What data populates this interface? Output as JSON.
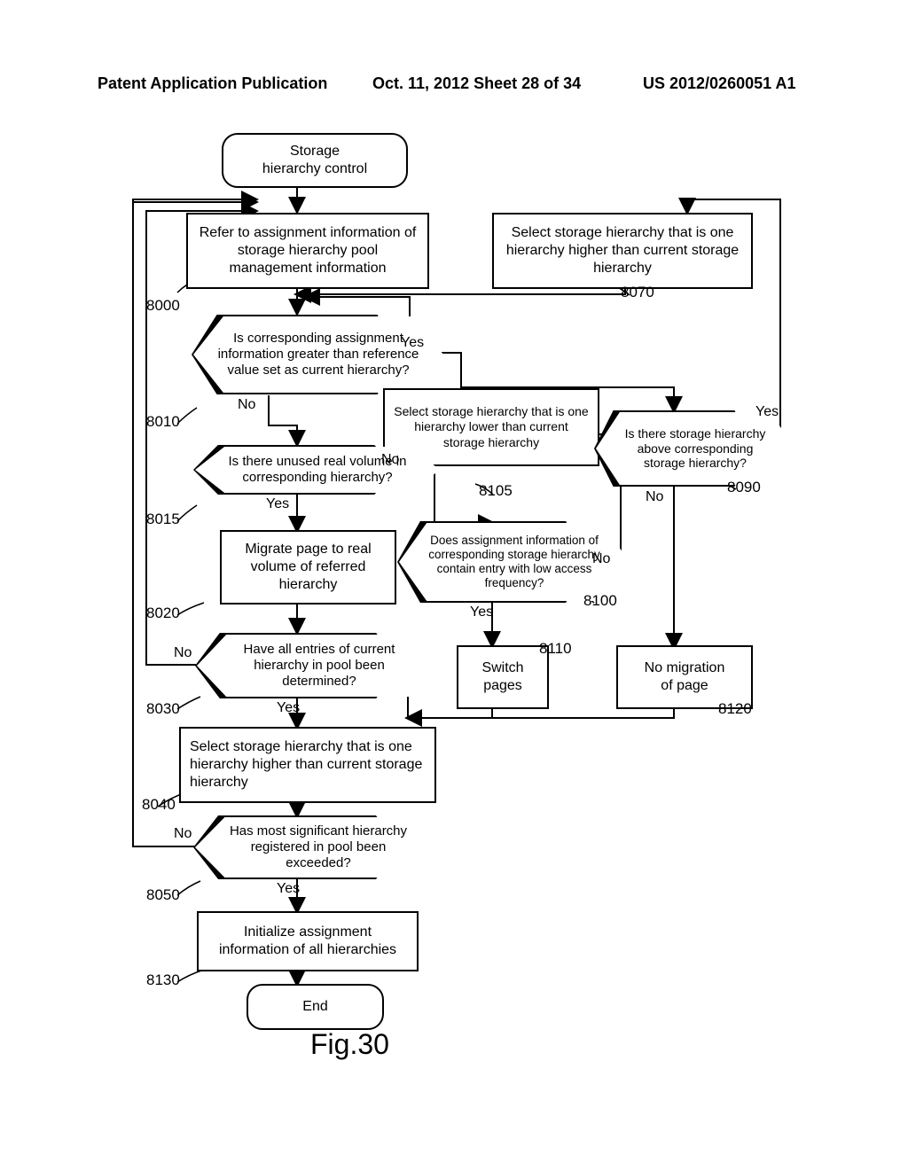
{
  "header": {
    "left": "Patent Application Publication",
    "center": "Oct. 11, 2012  Sheet 28 of 34",
    "right": "US 2012/0260051 A1"
  },
  "figure_label": "Fig.30",
  "nodes": {
    "start": "Storage\nhierarchy control",
    "n8000": "Refer to assignment information of storage hierarchy pool management information",
    "n8070": "Select storage hierarchy that is one hierarchy higher than current storage hierarchy",
    "n8010": "Is corresponding assignment information greater than reference value set as current hierarchy?",
    "n8105": "Select storage hierarchy that is one hierarchy lower than current storage hierarchy",
    "n8090": "Is there storage hierarchy above corresponding storage hierarchy?",
    "n8015": "Is there unused real volume in corresponding hierarchy?",
    "n8020": "Migrate page to real volume of referred hierarchy",
    "n8100": "Does assignment information of corresponding storage hierarchy contain entry with low access frequency?",
    "n8110": "Switch\npages",
    "n8120": "No migration\nof page",
    "n8030": "Have all entries of current hierarchy in pool been determined?",
    "n8040": "Select storage hierarchy that is one hierarchy higher than current storage hierarchy",
    "n8050": "Has most significant hierarchy registered in pool been exceeded?",
    "n8130": "Initialize assignment information of all hierarchies",
    "end": "End"
  },
  "edge_labels": {
    "n8010_yes": "Yes",
    "n8010_no": "No",
    "n8015_yes": "Yes",
    "n8015_no": "No",
    "n8100_yes": "Yes",
    "n8100_no": "No",
    "n8090_yes": "Yes",
    "n8090_no": "No",
    "n8030_yes": "Yes",
    "n8030_no": "No",
    "n8050_yes": "Yes",
    "n8050_no": "No"
  },
  "refs": {
    "r8000": "8000",
    "r8010": "8010",
    "r8015": "8015",
    "r8020": "8020",
    "r8030": "8030",
    "r8040": "8040",
    "r8050": "8050",
    "r8070": "8070",
    "r8090": "8090",
    "r8100": "8100",
    "r8105": "8105",
    "r8110": "8110",
    "r8120": "8120",
    "r8130": "8130"
  },
  "chart_data": {
    "type": "flowchart",
    "title": "Fig.30 — Storage hierarchy control",
    "nodes": [
      {
        "id": "start",
        "kind": "terminator",
        "text": "Storage hierarchy control"
      },
      {
        "id": "8000",
        "kind": "process",
        "text": "Refer to assignment information of storage hierarchy pool management information"
      },
      {
        "id": "8070",
        "kind": "process",
        "text": "Select storage hierarchy that is one hierarchy higher than current storage hierarchy"
      },
      {
        "id": "8010",
        "kind": "decision",
        "text": "Is corresponding assignment information greater than reference value set as current hierarchy?"
      },
      {
        "id": "8105",
        "kind": "process",
        "text": "Select storage hierarchy that is one hierarchy lower than current storage hierarchy"
      },
      {
        "id": "8090",
        "kind": "decision",
        "text": "Is there storage hierarchy above corresponding storage hierarchy?"
      },
      {
        "id": "8015",
        "kind": "decision",
        "text": "Is there unused real volume in corresponding hierarchy?"
      },
      {
        "id": "8020",
        "kind": "process",
        "text": "Migrate page to real volume of referred hierarchy"
      },
      {
        "id": "8100",
        "kind": "decision",
        "text": "Does assignment information of corresponding storage hierarchy contain entry with low access frequency?"
      },
      {
        "id": "8110",
        "kind": "process",
        "text": "Switch pages"
      },
      {
        "id": "8120",
        "kind": "process",
        "text": "No migration of page"
      },
      {
        "id": "8030",
        "kind": "decision",
        "text": "Have all entries of current hierarchy in pool been determined?"
      },
      {
        "id": "8040",
        "kind": "process",
        "text": "Select storage hierarchy that is one hierarchy higher than current storage hierarchy"
      },
      {
        "id": "8050",
        "kind": "decision",
        "text": "Has most significant hierarchy registered in pool been exceeded?"
      },
      {
        "id": "8130",
        "kind": "process",
        "text": "Initialize assignment information of all hierarchies"
      },
      {
        "id": "end",
        "kind": "terminator",
        "text": "End"
      }
    ],
    "edges": [
      {
        "from": "start",
        "to": "8000"
      },
      {
        "from": "8000",
        "to": "8010"
      },
      {
        "from": "8010",
        "to": "8015",
        "label": "No"
      },
      {
        "from": "8010",
        "to": "8090",
        "label": "Yes"
      },
      {
        "from": "8090",
        "to": "8070",
        "label": "Yes"
      },
      {
        "from": "8070",
        "to": "8010"
      },
      {
        "from": "8090",
        "to": "8120",
        "label": "No"
      },
      {
        "from": "8015",
        "to": "8020",
        "label": "Yes"
      },
      {
        "from": "8015",
        "to": "8100",
        "label": "No"
      },
      {
        "from": "8100",
        "to": "8110",
        "label": "Yes"
      },
      {
        "from": "8100",
        "to": "8105",
        "label": "No"
      },
      {
        "from": "8105",
        "to": "8010"
      },
      {
        "from": "8110",
        "to": "8030"
      },
      {
        "from": "8120",
        "to": "8030"
      },
      {
        "from": "8020",
        "to": "8030"
      },
      {
        "from": "8030",
        "to": "8040",
        "label": "Yes"
      },
      {
        "from": "8030",
        "to": "8000",
        "label": "No"
      },
      {
        "from": "8040",
        "to": "8050"
      },
      {
        "from": "8050",
        "to": "8000",
        "label": "No"
      },
      {
        "from": "8050",
        "to": "8130",
        "label": "Yes"
      },
      {
        "from": "8130",
        "to": "end"
      }
    ]
  }
}
